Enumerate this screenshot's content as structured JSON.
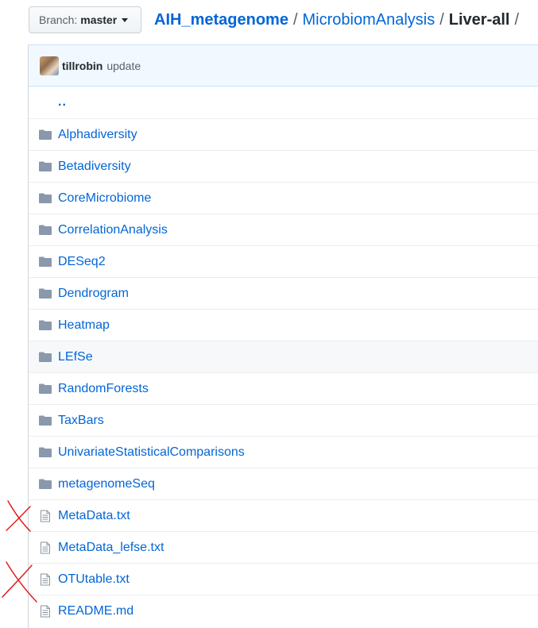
{
  "branch": {
    "label": "Branch:",
    "value": "master"
  },
  "breadcrumb": {
    "repo": "AIH_metagenome",
    "separator": "/",
    "folder": "MicrobiomAnalysis",
    "current": "Liver-all",
    "trailing": "/"
  },
  "commit": {
    "author": "tillrobin",
    "message": "update"
  },
  "files": {
    "parent": "..",
    "items": [
      {
        "name": "Alphadiversity",
        "type": "folder"
      },
      {
        "name": "Betadiversity",
        "type": "folder"
      },
      {
        "name": "CoreMicrobiome",
        "type": "folder"
      },
      {
        "name": "CorrelationAnalysis",
        "type": "folder"
      },
      {
        "name": "DESeq2",
        "type": "folder"
      },
      {
        "name": "Dendrogram",
        "type": "folder"
      },
      {
        "name": "Heatmap",
        "type": "folder"
      },
      {
        "name": "LEfSe",
        "type": "folder"
      },
      {
        "name": "RandomForests",
        "type": "folder"
      },
      {
        "name": "TaxBars",
        "type": "folder"
      },
      {
        "name": "UnivariateStatisticalComparisons",
        "type": "folder"
      },
      {
        "name": "metagenomeSeq",
        "type": "folder"
      },
      {
        "name": "MetaData.txt",
        "type": "file"
      },
      {
        "name": "MetaData_lefse.txt",
        "type": "file"
      },
      {
        "name": "OTUtable.txt",
        "type": "file"
      },
      {
        "name": "README.md",
        "type": "file"
      }
    ]
  },
  "colors": {
    "link": "#0366d6",
    "folder_icon": "#79b8ff",
    "annotation_mark": "#e02020"
  },
  "icons": {
    "folder": "folder-icon",
    "file": "file-text-icon",
    "caret": "caret-down-icon"
  }
}
